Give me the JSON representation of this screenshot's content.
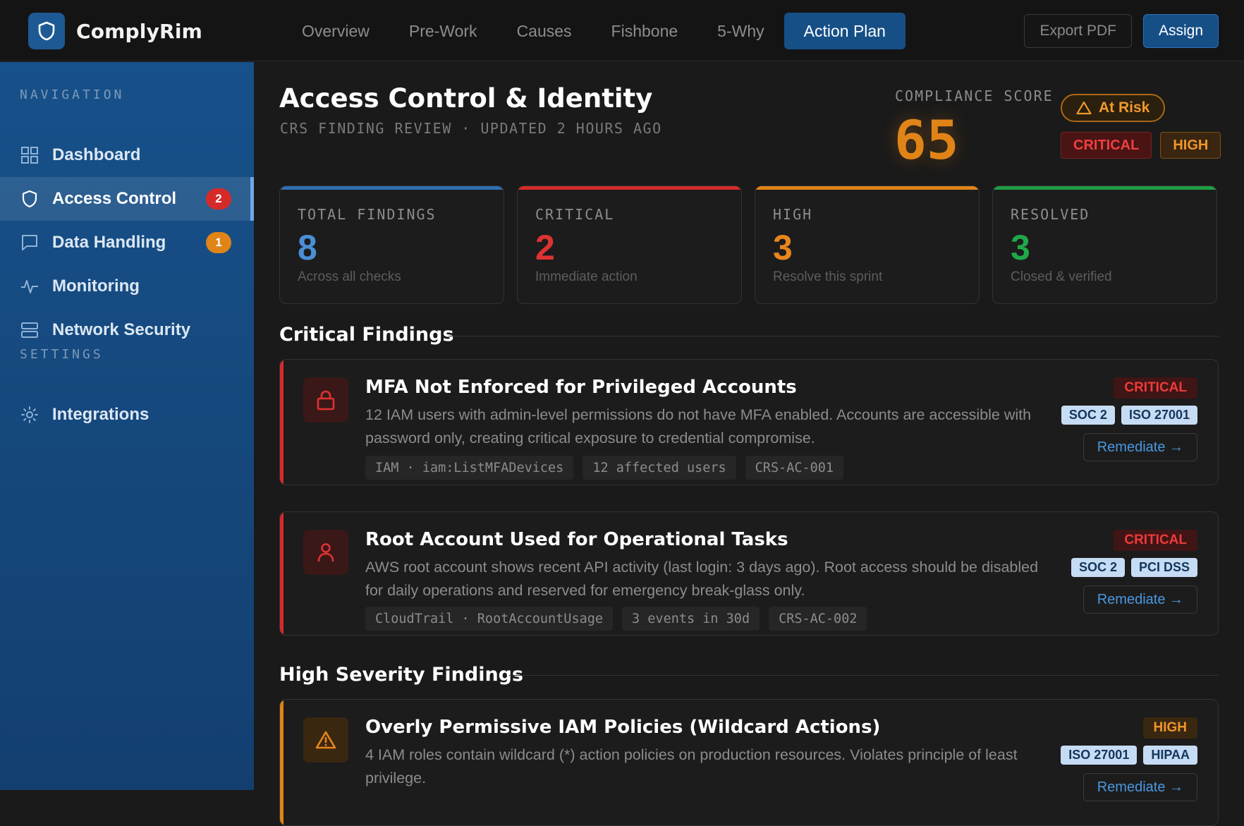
{
  "app": {
    "name": "ComplyRim"
  },
  "tabs": [
    {
      "label": "Overview"
    },
    {
      "label": "Pre-Work"
    },
    {
      "label": "Causes"
    },
    {
      "label": "Fishbone"
    },
    {
      "label": "5-Why"
    },
    {
      "label": "Action Plan",
      "active": true
    }
  ],
  "header_actions": {
    "export_label": "Export PDF",
    "assign_label": "Assign"
  },
  "sidebar": {
    "nav_section": "NAVIGATION",
    "settings_section": "SETTINGS",
    "items": [
      {
        "label": "Dashboard",
        "icon": "dashboard-grid-icon"
      },
      {
        "label": "Access Control",
        "icon": "shield-icon",
        "badge": "2",
        "active": true
      },
      {
        "label": "Data Handling",
        "icon": "chat-bubble-icon",
        "badge": "1"
      },
      {
        "label": "Monitoring",
        "icon": "activity-pulse-icon"
      },
      {
        "label": "Network Security",
        "icon": "server-icon"
      }
    ],
    "settings_items": [
      {
        "label": "Integrations",
        "icon": "gear-icon"
      }
    ]
  },
  "page": {
    "title": "Access Control & Identity",
    "subtitle": "CRS FINDING REVIEW · UPDATED 2 HOURS AGO",
    "score_label": "COMPLIANCE SCORE",
    "score_value": "65",
    "risk_label": "At Risk",
    "severity_tags": {
      "critical": "CRITICAL",
      "high": "HIGH"
    }
  },
  "stats": [
    {
      "label": "TOTAL FINDINGS",
      "value": "8",
      "caption": "Across all checks",
      "color": "#4a8fd6"
    },
    {
      "label": "CRITICAL",
      "value": "2",
      "caption": "Immediate action",
      "color": "#e03232"
    },
    {
      "label": "HIGH",
      "value": "3",
      "caption": "Resolve this sprint",
      "color": "#e8861c"
    },
    {
      "label": "RESOLVED",
      "value": "3",
      "caption": "Closed & verified",
      "color": "#20a848"
    }
  ],
  "sections": {
    "critical": "Critical Findings",
    "high": "High Severity Findings"
  },
  "findings": [
    {
      "title": "MFA Not Enforced for Privileged Accounts",
      "description": "12 IAM users with admin-level permissions do not have MFA enabled. Accounts are accessible with password only, creating critical exposure to credential compromise.",
      "chips": [
        "IAM · iam:ListMFADevices",
        "12 affected users",
        "CRS-AC-001"
      ],
      "severity": "CRITICAL",
      "frameworks": [
        "SOC 2",
        "ISO 27001"
      ],
      "action": "Remediate →",
      "icon": "lock-icon"
    },
    {
      "title": "Root Account Used for Operational Tasks",
      "description": "AWS root account shows recent API activity (last login: 3 days ago). Root access should be disabled for daily operations and reserved for emergency break-glass only.",
      "chips": [
        "CloudTrail · RootAccountUsage",
        "3 events in 30d",
        "CRS-AC-002"
      ],
      "severity": "CRITICAL",
      "frameworks": [
        "SOC 2",
        "PCI DSS"
      ],
      "action": "Remediate →",
      "icon": "user-icon"
    },
    {
      "title": "Overly Permissive IAM Policies (Wildcard Actions)",
      "description": "4 IAM roles contain wildcard (*) action policies on production resources. Violates principle of least privilege.",
      "severity": "HIGH",
      "frameworks": [
        "ISO 27001",
        "HIPAA"
      ],
      "action": "Remediate →",
      "icon": "warning-triangle-icon"
    }
  ],
  "colors": {
    "accent": "#164f86",
    "critical": "#e03232",
    "high": "#e8861c",
    "resolved": "#20a848",
    "info": "#4a8fd6"
  }
}
